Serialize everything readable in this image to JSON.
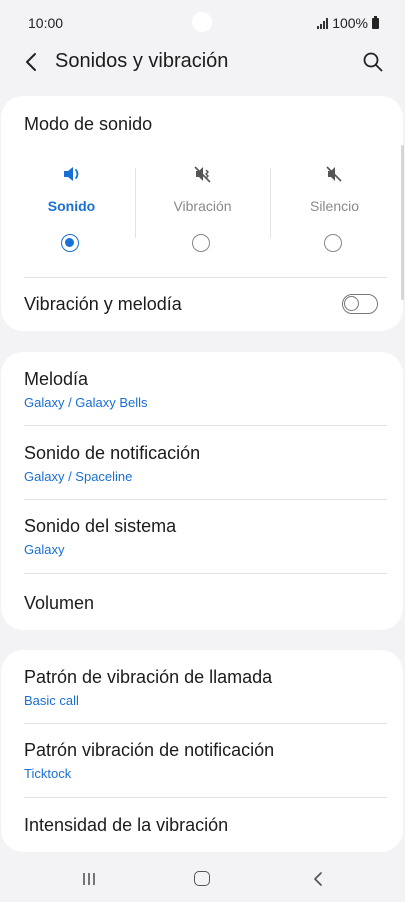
{
  "status": {
    "time": "10:00",
    "battery": "100%"
  },
  "header": {
    "title": "Sonidos y vibración"
  },
  "sound_mode": {
    "title": "Modo de sonido",
    "options": [
      {
        "label": "Sonido",
        "selected": true
      },
      {
        "label": "Vibración",
        "selected": false
      },
      {
        "label": "Silencio",
        "selected": false
      }
    ],
    "vibration_melody_label": "Vibración y melodía",
    "vibration_melody_on": false
  },
  "sounds": [
    {
      "label": "Melodía",
      "value": "Galaxy / Galaxy Bells"
    },
    {
      "label": "Sonido de notificación",
      "value": "Galaxy / Spaceline"
    },
    {
      "label": "Sonido del sistema",
      "value": "Galaxy"
    },
    {
      "label": "Volumen"
    }
  ],
  "vibration": [
    {
      "label": "Patrón de vibración de llamada",
      "value": "Basic call"
    },
    {
      "label": "Patrón vibración de notificación",
      "value": "Ticktock"
    },
    {
      "label": "Intensidad de la vibración"
    }
  ],
  "colors": {
    "accent": "#1a6fd4",
    "background": "#f3f3f5",
    "card": "#ffffff"
  }
}
